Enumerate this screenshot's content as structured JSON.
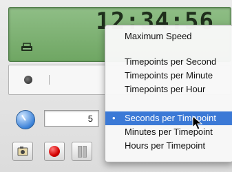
{
  "display": {
    "time": "12:34:56"
  },
  "controls": {
    "step_value": "5"
  },
  "menu": {
    "items": [
      {
        "label": "Maximum Speed"
      },
      {
        "label": "Timepoints per Second"
      },
      {
        "label": "Timepoints per Minute"
      },
      {
        "label": "Timepoints per Hour"
      },
      {
        "label": "Seconds per Timepoint",
        "selected": true,
        "check": "•"
      },
      {
        "label": "Minutes per Timepoint"
      },
      {
        "label": "Hours per Timepoint"
      }
    ]
  },
  "colors": {
    "menu_highlight": "#3b79d6",
    "lcd_green": "#7fb374",
    "record_red": "#d40000"
  },
  "icons": [
    "printer-icon",
    "clock-icon",
    "camera-icon",
    "record-icon",
    "pause-icon",
    "arrow-cursor-icon"
  ]
}
